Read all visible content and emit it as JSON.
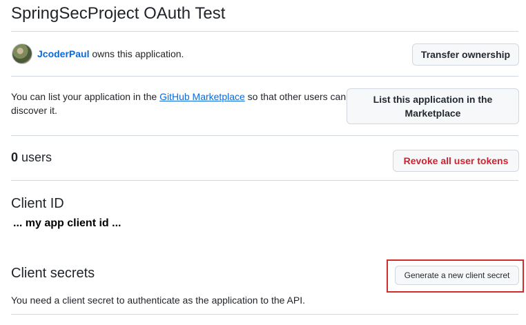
{
  "app": {
    "title": "SpringSecProject OAuth Test"
  },
  "owner": {
    "username": "JcoderPaul",
    "suffix": " owns this application.",
    "transfer_label": "Transfer ownership"
  },
  "marketplace": {
    "text_before": "You can list your application in the ",
    "link_text": "GitHub Marketplace",
    "text_after": " so that other users can discover it.",
    "button_label": "List this application in the Marketplace"
  },
  "users": {
    "count": "0",
    "label": " users",
    "revoke_label": "Revoke all user tokens"
  },
  "client_id": {
    "heading": "Client ID",
    "value": "... my app client id ..."
  },
  "client_secrets": {
    "heading": "Client secrets",
    "generate_label": "Generate a new client secret",
    "description": "You need a client secret to authenticate as the application to the API."
  },
  "colors": {
    "link": "#0969da",
    "danger": "#cf222e",
    "highlight": "#d22b2b",
    "border": "#d0d7de"
  }
}
